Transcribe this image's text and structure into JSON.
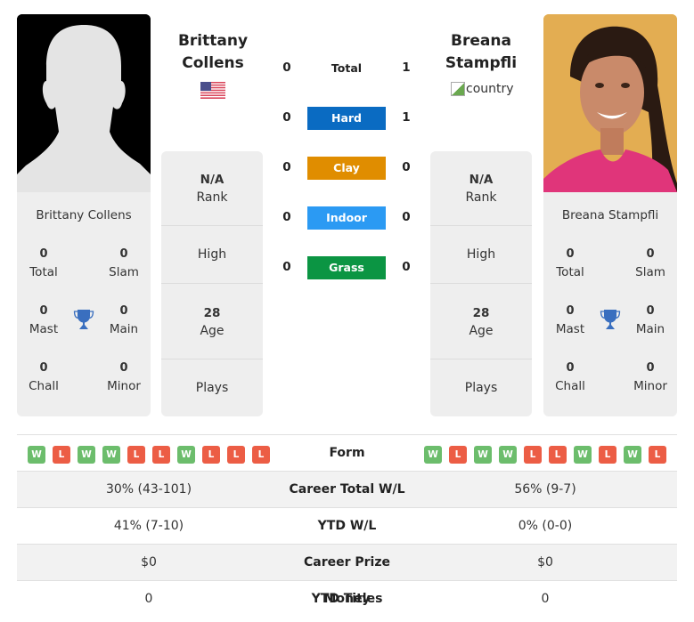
{
  "player1": {
    "name": "Brittany Collens",
    "name_line1": "Brittany",
    "name_line2": "Collens",
    "country_flag": "usa-flag-icon",
    "titles": {
      "total": "0",
      "slam": "0",
      "mast": "0",
      "main": "0",
      "chall": "0",
      "minor": "0"
    },
    "rank": "N/A",
    "high": "",
    "age": "28",
    "plays": "",
    "form": [
      "W",
      "L",
      "W",
      "W",
      "L",
      "L",
      "W",
      "L",
      "L",
      "L"
    ],
    "career_total_wl": "30% (43-101)",
    "ytd_wl": "41% (7-10)",
    "career_prize_money": "$0",
    "ytd_titles": "0"
  },
  "player2": {
    "name": "Breana Stampfli",
    "name_line1": "Breana",
    "name_line2": "Stampfli",
    "country_alt": "country",
    "titles": {
      "total": "0",
      "slam": "0",
      "mast": "0",
      "main": "0",
      "chall": "0",
      "minor": "0"
    },
    "rank": "N/A",
    "high": "",
    "age": "28",
    "plays": "",
    "form": [
      "W",
      "L",
      "W",
      "W",
      "L",
      "L",
      "W",
      "L",
      "W",
      "L"
    ],
    "career_total_wl": "56% (9-7)",
    "ytd_wl": "0% (0-0)",
    "career_prize_money": "$0",
    "ytd_titles": "0"
  },
  "labels": {
    "total": "Total",
    "slam": "Slam",
    "mast": "Mast",
    "main": "Main",
    "chall": "Chall",
    "minor": "Minor",
    "rank": "Rank",
    "high": "High",
    "age": "Age",
    "plays": "Plays",
    "form": "Form",
    "career_total_wl": "Career Total W/L",
    "ytd_wl": "YTD W/L",
    "career_prize_money": "Career Prize Money",
    "ytd_titles": "YTD Titles"
  },
  "h2h": [
    {
      "label": "Total",
      "p1": "0",
      "p2": "1",
      "color": ""
    },
    {
      "label": "Hard",
      "p1": "0",
      "p2": "1",
      "color": "#0a6bc2"
    },
    {
      "label": "Clay",
      "p1": "0",
      "p2": "0",
      "color": "#e08d00"
    },
    {
      "label": "Indoor",
      "p1": "0",
      "p2": "0",
      "color": "#2b9af3"
    },
    {
      "label": "Grass",
      "p1": "0",
      "p2": "0",
      "color": "#0b9543"
    }
  ],
  "colors": {
    "win": "#6cbd6c",
    "loss": "#ec5d45",
    "trophy": "#3a6fbf"
  }
}
